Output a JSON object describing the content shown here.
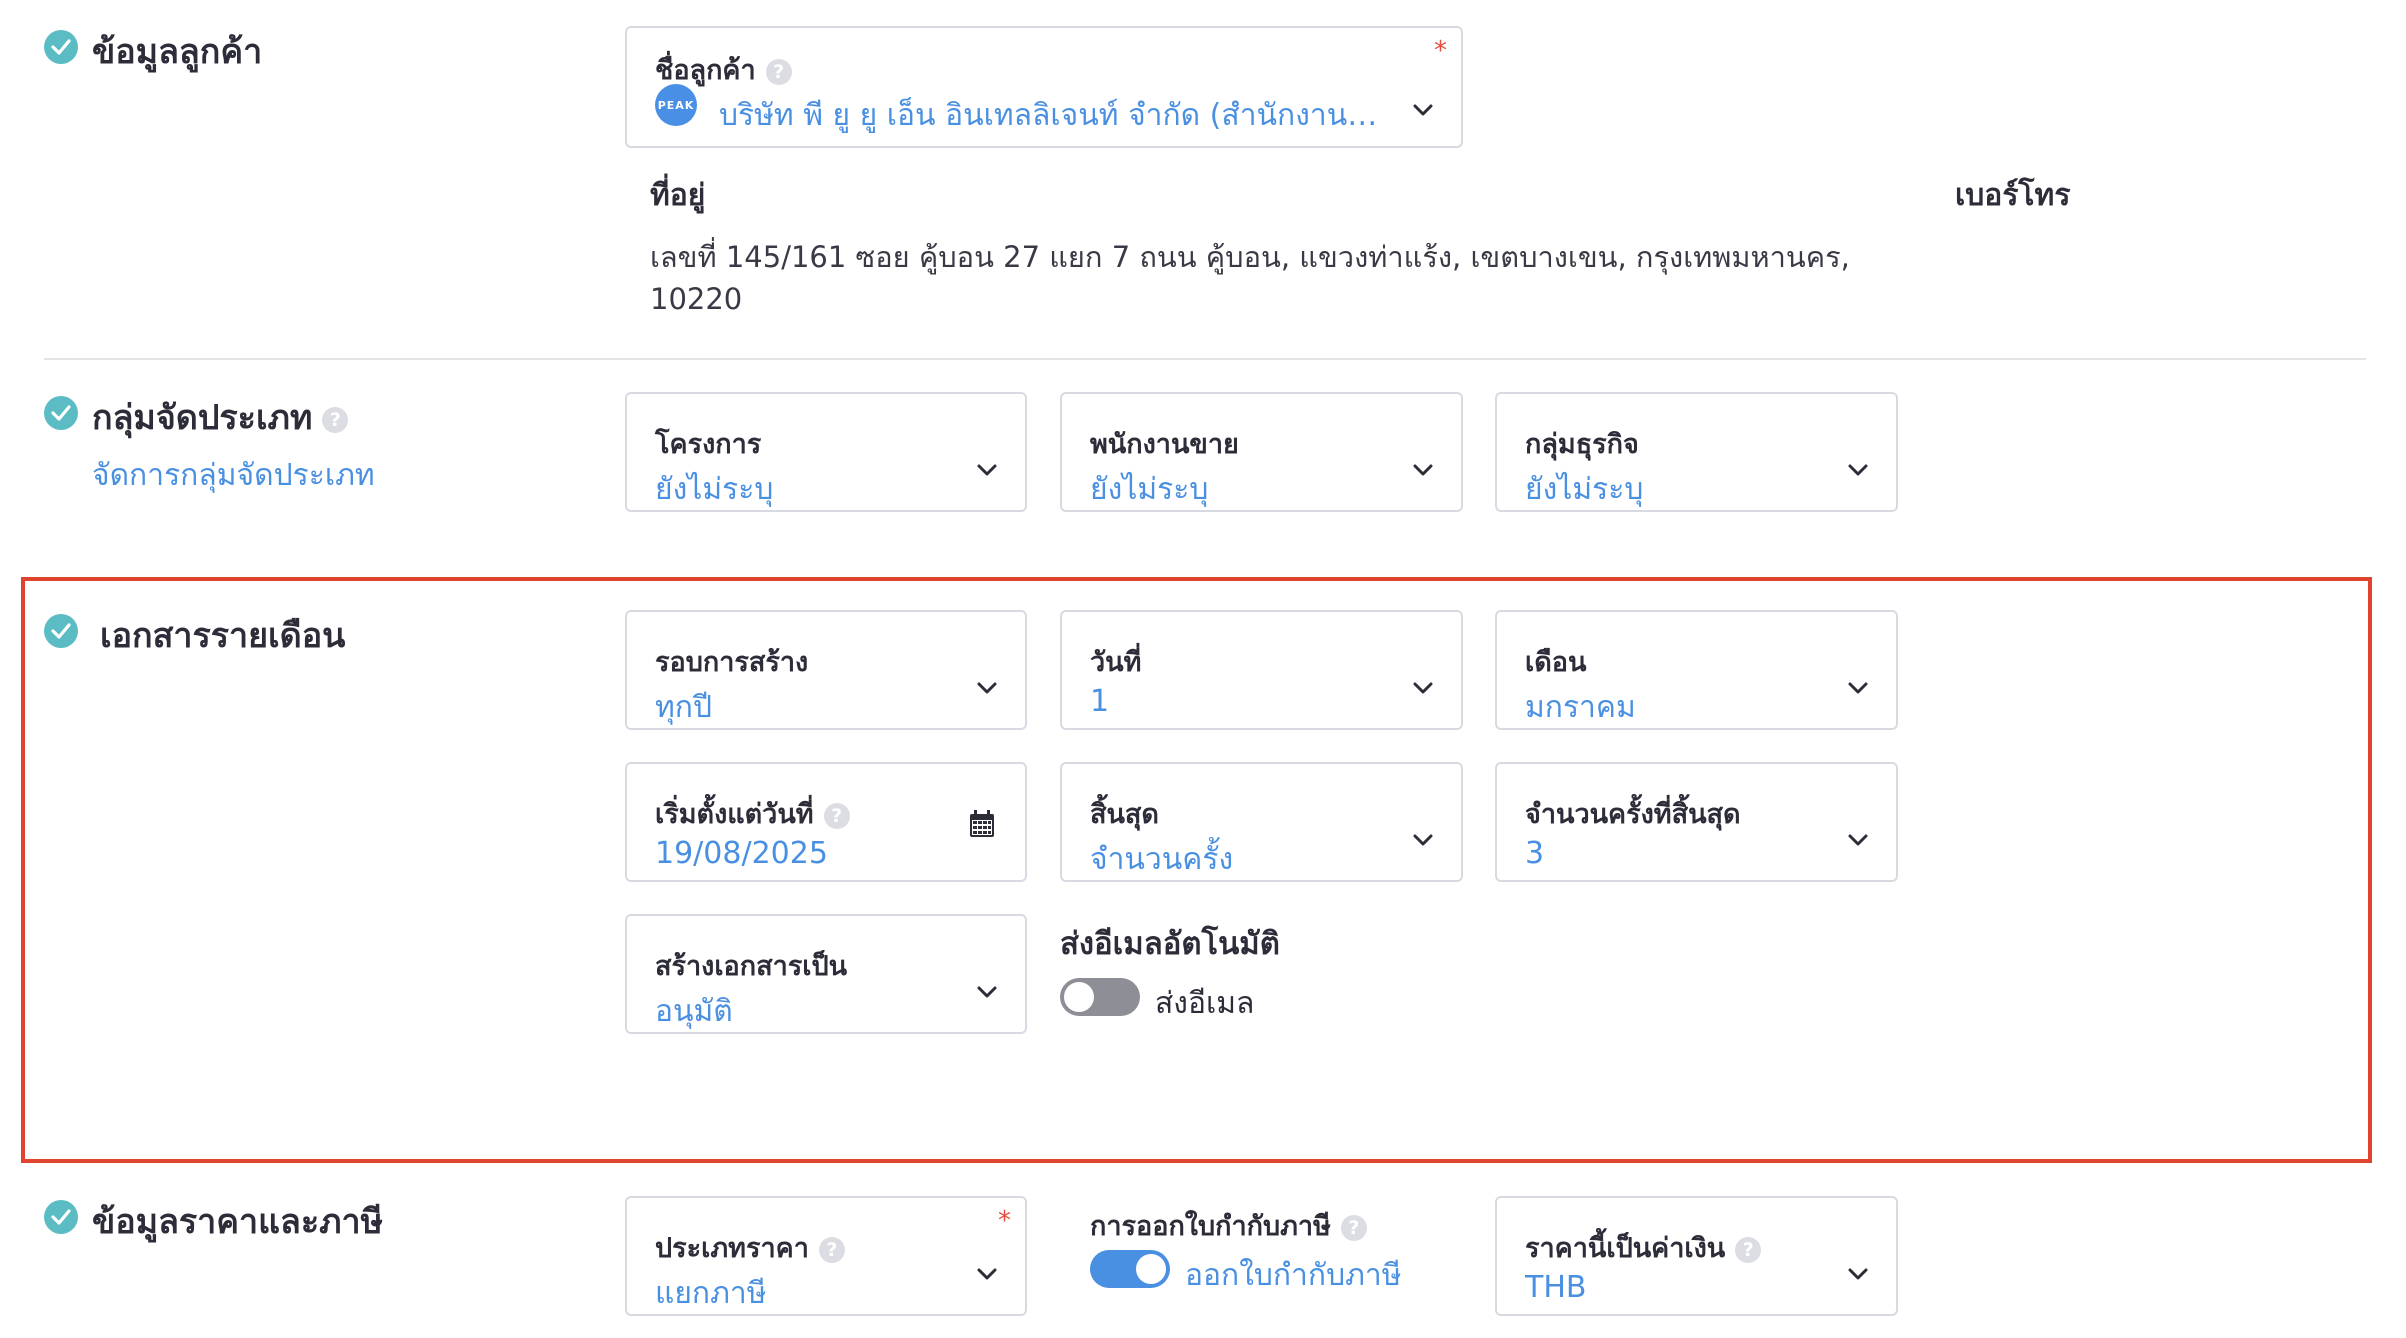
{
  "customer": {
    "section_title": "ข้อมูลลูกค้า",
    "name_label": "ชื่อลูกค้า",
    "required_mark": "*",
    "logo_text": "PEAK",
    "name_value": "บริษัท พี ยู ยู เอ็น อินเทลลิเจนท์ จำกัด (สำนักงานให...",
    "address_label": "ที่อยู่",
    "address_line1": "เลขที่ 145/161 ซอย คู้บอน 27 แยก 7 ถนน คู้บอน, แขวงท่าแร้ง, เขตบางเขน, กรุงเทพมหานคร,",
    "address_line2": "10220",
    "phone_label": "เบอร์โทร"
  },
  "classification": {
    "section_title": "กลุ่มจัดประเภท",
    "manage_link": "จัดการกลุ่มจัดประเภท",
    "project_label": "โครงการ",
    "project_value": "ยังไม่ระบุ",
    "salesperson_label": "พนักงานขาย",
    "salesperson_value": "ยังไม่ระบุ",
    "business_group_label": "กลุ่มธุรกิจ",
    "business_group_value": "ยังไม่ระบุ"
  },
  "recurring": {
    "section_title": "เอกสารรายเดือน",
    "cycle_label": "รอบการสร้าง",
    "cycle_value": "ทุกปี",
    "day_label": "วันที่",
    "day_value": "1",
    "month_label": "เดือน",
    "month_value": "มกราคม",
    "start_label": "เริ่มตั้งแต่วันที่",
    "start_value": "19/08/2025",
    "end_label": "สิ้นสุด",
    "end_value": "จำนวนครั้ง",
    "end_count_label": "จำนวนครั้งที่สิ้นสุด",
    "end_count_value": "3",
    "create_as_label": "สร้างเอกสารเป็น",
    "create_as_value": "อนุมัติ",
    "auto_email_label": "ส่งอีเมลอัตโนมัติ",
    "send_email_label": "ส่งอีเมล",
    "send_email_enabled": false
  },
  "pricing": {
    "section_title": "ข้อมูลราคาและภาษี",
    "price_type_label": "ประเภทราคา",
    "price_type_value": "แยกภาษี",
    "tax_invoice_label": "การออกใบกำกับภาษี",
    "tax_invoice_toggle_label": "ออกใบกำกับภาษี",
    "tax_invoice_enabled": true,
    "currency_label": "ราคานี้เป็นค่าเงิน",
    "currency_value": "THB"
  },
  "icons": {
    "check": "check-circle-icon",
    "help": "question-circle-icon",
    "chevron": "chevron-down-icon",
    "calendar": "calendar-icon"
  },
  "colors": {
    "accent_blue": "#4a90e2",
    "check_teal": "#5bbcc4",
    "highlight_red": "#e0442e",
    "toggle_on": "#4a90e2",
    "toggle_off": "#8e8e96"
  }
}
